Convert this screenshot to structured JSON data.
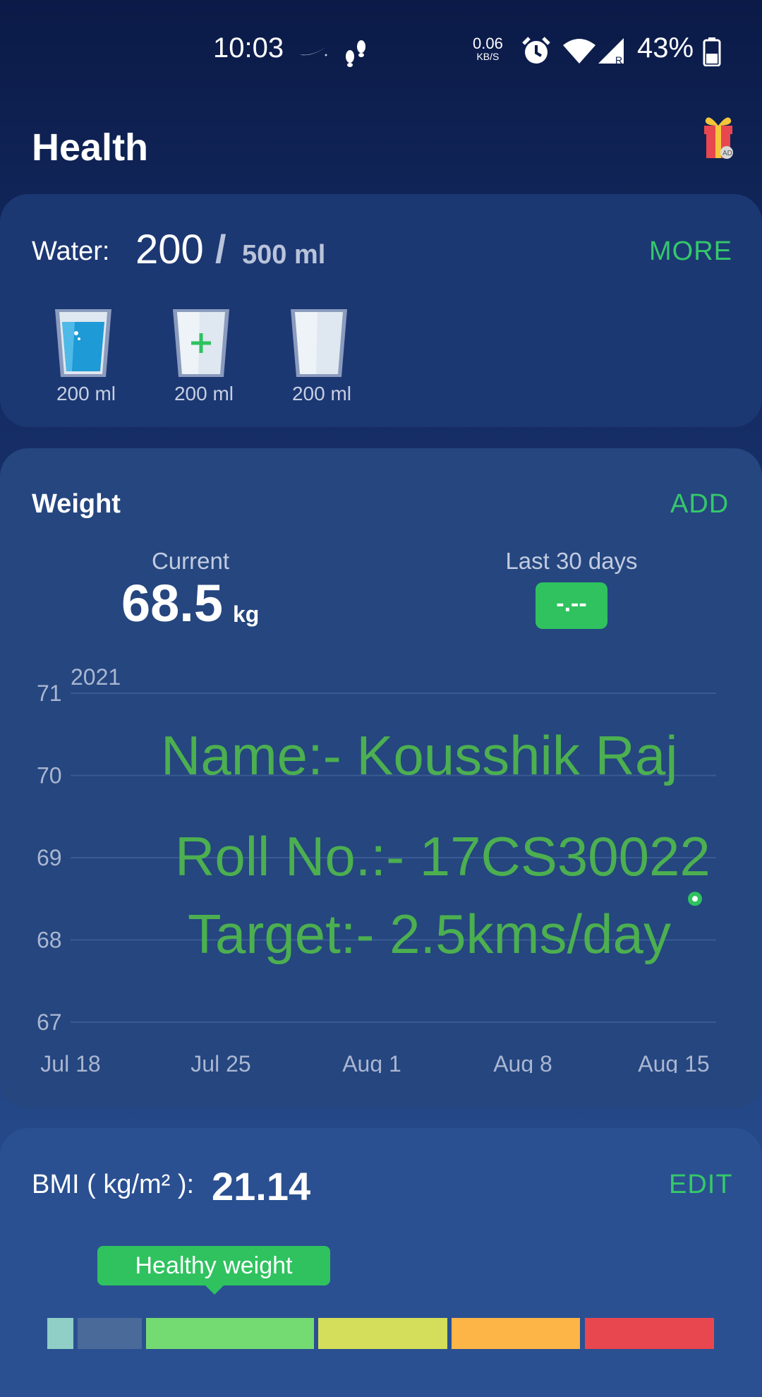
{
  "status_bar": {
    "time": "10:03",
    "net_speed_value": "0.06",
    "net_speed_unit": "KB/S",
    "battery": "43%",
    "icons": [
      "nike-swoosh-icon",
      "footsteps-icon",
      "alarm-icon",
      "wifi-icon",
      "signal-icon",
      "battery-icon"
    ]
  },
  "header": {
    "title": "Health",
    "gift_icon": "gift-ad-icon"
  },
  "water": {
    "label": "Water:",
    "current": "200",
    "separator": "/",
    "goal": "500 ml",
    "more_label": "MORE",
    "cups": [
      {
        "label": "200 ml",
        "state": "filled"
      },
      {
        "label": "200 ml",
        "state": "add"
      },
      {
        "label": "200 ml",
        "state": "empty"
      }
    ]
  },
  "weight": {
    "title": "Weight",
    "add_label": "ADD",
    "current_label": "Current",
    "current_value": "68.5",
    "current_unit": "kg",
    "last30_label": "Last 30 days",
    "last30_value": "-.--"
  },
  "chart_data": {
    "type": "scatter",
    "year_label": "2021",
    "x_ticks": [
      "Jul 18",
      "Jul 25",
      "Aug 1",
      "Aug 8",
      "Aug 15"
    ],
    "y_ticks": [
      71,
      70,
      69,
      68,
      67
    ],
    "ylim": [
      67,
      71
    ],
    "xlim": [
      "2021-07-18",
      "2021-08-15"
    ],
    "points": [
      {
        "x": "2021-08-16",
        "y": 68.5
      }
    ],
    "grid": true,
    "colors": {
      "point": "#2fc25f",
      "grid": "#3a5a94",
      "tick": "#aab6d1"
    }
  },
  "overlay": {
    "name_line": "Name:- Kousshik Raj",
    "roll_line": "Roll No.:- 17CS30022",
    "target_line": "Target:- 2.5kms/day"
  },
  "bmi": {
    "label": "BMI ( kg/m² ):",
    "value": "21.14",
    "edit_label": "EDIT",
    "category_label": "Healthy weight",
    "scale_colors": [
      "#8fcfc6",
      "#4a6a99",
      "#74db72",
      "#d4de5a",
      "#fdb547",
      "#e9474f"
    ]
  }
}
